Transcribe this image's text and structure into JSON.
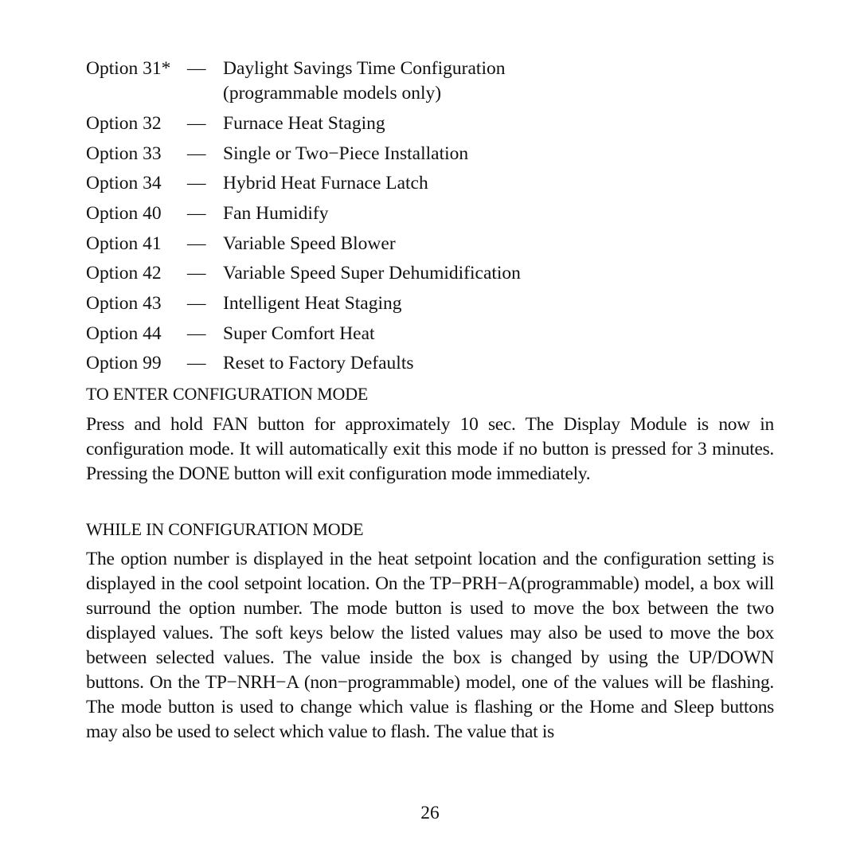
{
  "options": [
    {
      "label": "Option 31*",
      "dash": "—",
      "desc": "Daylight Savings Time Configuration",
      "desc2": "(programmable models only)"
    },
    {
      "label": "Option 32",
      "dash": "—",
      "desc": "Furnace Heat Staging"
    },
    {
      "label": "Option 33",
      "dash": "—",
      "desc": "Single or Two−Piece Installation"
    },
    {
      "label": "Option 34",
      "dash": "—",
      "desc": "Hybrid Heat Furnace Latch"
    },
    {
      "label": "Option 40",
      "dash": "—",
      "desc": "Fan Humidify"
    },
    {
      "label": "Option 41",
      "dash": "—",
      "desc": "Variable Speed Blower"
    },
    {
      "label": "Option 42",
      "dash": "—",
      "desc": "Variable Speed Super Dehumidification"
    },
    {
      "label": "Option 43",
      "dash": "—",
      "desc": "Intelligent Heat Staging"
    },
    {
      "label": "Option 44",
      "dash": "—",
      "desc": "Super Comfort Heat"
    },
    {
      "label": "Option 99",
      "dash": "—",
      "desc": "Reset to Factory Defaults"
    }
  ],
  "sections": [
    {
      "heading": "TO ENTER CONFIGURATION MODE",
      "body": "Press and hold FAN button for approximately 10 sec. The Display Module is now in configuration mode. It will automatically exit this mode if no button is pressed for 3 minutes. Pressing the DONE button will exit configuration mode immediately."
    },
    {
      "heading": "WHILE IN CONFIGURATION MODE",
      "body": "The option number is displayed in the heat setpoint location and the configuration setting is displayed in the cool setpoint location. On the TP−PRH−A(programmable) model, a box will surround the option number. The mode button is used to move the box between the two displayed values. The soft keys below the listed values may also be used to move the box between selected values. The value inside the box is changed by using the UP/DOWN buttons. On the TP−NRH−A (non−programmable) model, one of the values will be flashing. The mode button is used to change which value is flashing or the Home and Sleep buttons may also be used to select which value to flash. The value that is"
    }
  ],
  "page_number": "26"
}
